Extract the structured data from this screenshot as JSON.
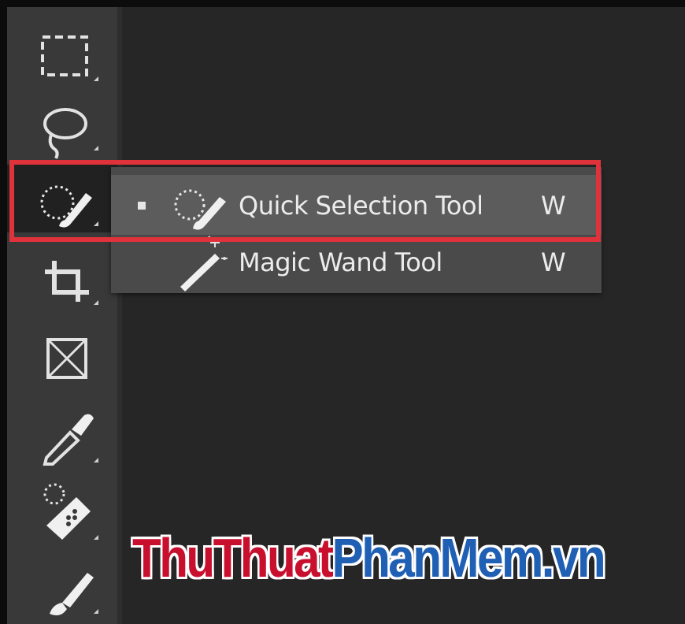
{
  "toolbar": {
    "tools": [
      {
        "name": "Rectangular Marquee Tool",
        "icon": "rectangular-marquee-icon"
      },
      {
        "name": "Lasso Tool",
        "icon": "lasso-icon"
      },
      {
        "name": "Quick Selection Tool",
        "icon": "quick-selection-icon",
        "active": true
      },
      {
        "name": "Crop Tool",
        "icon": "crop-icon"
      },
      {
        "name": "Frame Tool",
        "icon": "frame-icon"
      },
      {
        "name": "Eyedropper Tool",
        "icon": "eyedropper-icon"
      },
      {
        "name": "Spot Healing Brush Tool",
        "icon": "healing-brush-icon"
      },
      {
        "name": "Brush Tool",
        "icon": "brush-icon"
      }
    ]
  },
  "flyout": {
    "items": [
      {
        "label": "Quick Selection Tool",
        "shortcut": "W",
        "selected": true,
        "icon": "quick-selection-icon"
      },
      {
        "label": "Magic Wand Tool",
        "shortcut": "W",
        "selected": false,
        "icon": "magic-wand-icon"
      }
    ]
  },
  "watermark": {
    "part1": "ThuThuat",
    "part2": "PhanMem",
    "part3": ".vn"
  },
  "colors": {
    "highlight": "#e0323b",
    "panel": "#393939",
    "canvas": "#262626",
    "watermark_red": "#c8102e",
    "watermark_blue": "#1f5fb4"
  }
}
